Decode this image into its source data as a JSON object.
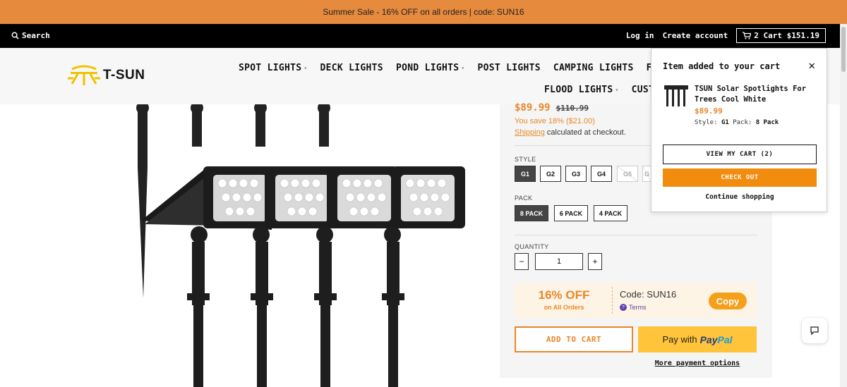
{
  "announcement": "Summer Sale - 16% OFF on all orders | code: SUN16",
  "topbar": {
    "search_label": "Search",
    "login": "Log in",
    "create_account": "Create account",
    "cart_label": "2 Cart $151.19"
  },
  "logo": {
    "text": "T-SUN"
  },
  "nav": {
    "row1": [
      "SPOT LIGHTS",
      "DECK LIGHTS",
      "POND LIGHTS",
      "POST LIGHTS",
      "CAMPING LIGHTS",
      "FLOO"
    ],
    "row2": [
      "FLOOD LIGHTS",
      "CUST"
    ]
  },
  "product": {
    "price": "$89.99",
    "compare_price": "$110.99",
    "savings": "You save 18% ($21.00)",
    "shipping_link": "Shipping",
    "shipping_rest": "calculated at checkout.",
    "style_label": "STYLE",
    "styles": [
      "G1",
      "G2",
      "G3",
      "G4",
      "G5",
      "G"
    ],
    "pack_label": "PACK",
    "packs": [
      "8 PACK",
      "6 PACK",
      "4 PACK"
    ],
    "quantity_label": "QUANTITY",
    "quantity": "1",
    "qty_minus": "−",
    "qty_plus": "+",
    "add_to_cart": "ADD TO CART",
    "paypal_prefix": "Pay with",
    "paypal_brand1": "Pay",
    "paypal_brand2": "Pal",
    "more_payment": "More payment options"
  },
  "promo": {
    "big": "16% OFF",
    "small": "on All Orders",
    "code": "Code: SUN16",
    "terms": "Terms",
    "copy": "Copy"
  },
  "popup": {
    "heading": "Item added to your cart",
    "close": "✕",
    "item_title": "TSUN Solar Spotlights For Trees Cool White",
    "item_price": "$89.99",
    "style_key": "Style:",
    "style_val": "G1",
    "pack_key": "Pack:",
    "pack_val": "8 Pack",
    "view_cart": "VIEW MY CART (2)",
    "checkout": "CHECK OUT",
    "continue": "Continue shopping"
  },
  "colors": {
    "accent": "#e8872a",
    "announce_bg": "#e68a3e",
    "checkout_bg": "#f28c0f",
    "paypal_bg": "#ffc439",
    "logo_yellow": "#f2c200"
  },
  "icons": [
    "search-icon",
    "cart-icon",
    "sun-logo-icon",
    "close-icon",
    "chat-icon",
    "terms-info-icon"
  ]
}
